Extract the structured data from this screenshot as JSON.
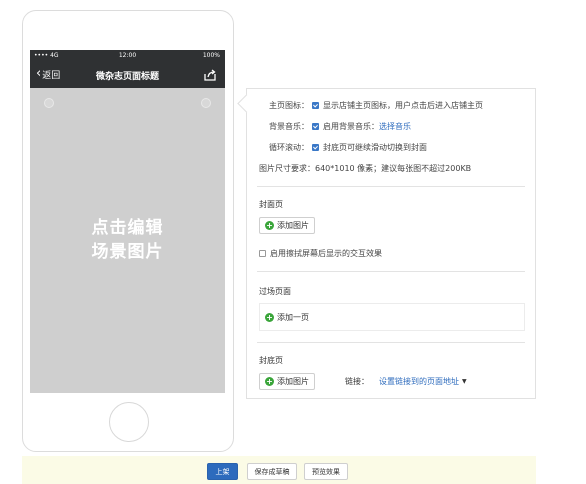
{
  "phone": {
    "status_bar": {
      "signal": "•••• 4G",
      "time": "12:00",
      "battery": "100%"
    },
    "nav": {
      "back_label": "返回",
      "title": "微杂志页面标题"
    },
    "edit_hint_line1": "点击编辑",
    "edit_hint_line2": "场景图片"
  },
  "settings": {
    "homepage_icon": {
      "label": "主页图标：",
      "text": "显示店铺主页图标，用户点击后进入店铺主页",
      "checked": true
    },
    "bg_music": {
      "label": "背景音乐：",
      "text": "启用背景音乐：",
      "link": "选择音乐",
      "checked": true
    },
    "loop_scroll": {
      "label": "循环滚动：",
      "text": "封底页可继续滑动切换到封面",
      "checked": true
    },
    "image_size": "图片尺寸要求：640*1010 像素；建议每张图不超过200KB",
    "cover": {
      "title": "封面页",
      "add_image": "添加图片",
      "wipe_text": "启用擦拭屏幕后显示的交互效果",
      "wipe_checked": false
    },
    "transition": {
      "title": "过场页面",
      "add_page": "添加一页"
    },
    "back_cover": {
      "title": "封底页",
      "add_image": "添加图片",
      "link_label": "链接：",
      "link_value": "设置链接到的页面地址"
    }
  },
  "footer": {
    "publish": "上架",
    "save_draft": "保存成草稿",
    "preview": "预览效果"
  },
  "colors": {
    "accent": "#2d6bbd",
    "nav_bar": "#2f3133",
    "add_icon": "#3aa53a",
    "footer_bg": "#fbfbe6"
  }
}
